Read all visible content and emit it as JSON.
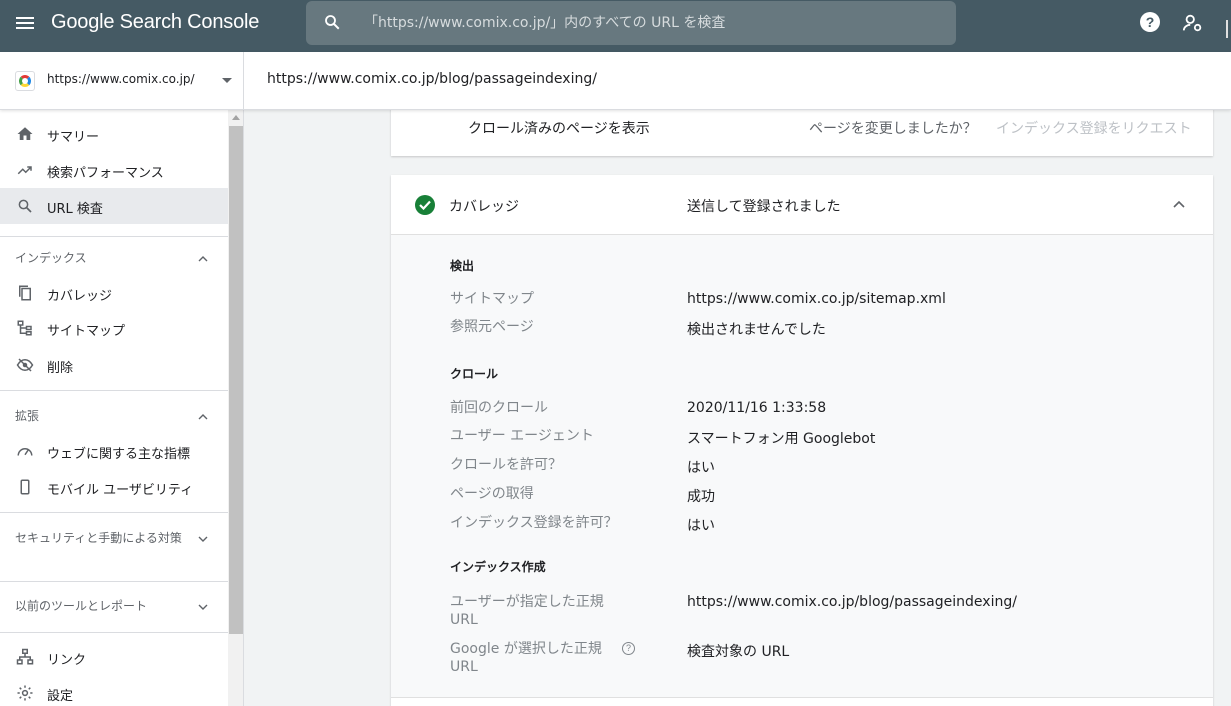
{
  "app": {
    "title": "Google Search Console",
    "search_placeholder": "「https://www.comix.co.jp/」内のすべての URL を検査",
    "help_label": "?"
  },
  "property": {
    "name": "https://www.comix.co.jp/",
    "inspected_url": "https://www.comix.co.jp/blog/passageindexing/"
  },
  "sidebar": {
    "top_items": [
      {
        "label": "サマリー",
        "icon": "home-icon"
      },
      {
        "label": "検索パフォーマンス",
        "icon": "trending-up-icon"
      },
      {
        "label": "URL 検査",
        "icon": "search-icon",
        "active": true
      }
    ],
    "sections": [
      {
        "label": "インデックス",
        "expanded": true,
        "items": [
          {
            "label": "カバレッジ",
            "icon": "copy-icon"
          },
          {
            "label": "サイトマップ",
            "icon": "sitemap-icon"
          },
          {
            "label": "削除",
            "icon": "eye-off-icon"
          }
        ]
      },
      {
        "label": "拡張",
        "expanded": true,
        "items": [
          {
            "label": "ウェブに関する主な指標",
            "icon": "speedometer-icon"
          },
          {
            "label": "モバイル ユーザビリティ",
            "icon": "smartphone-icon"
          }
        ]
      },
      {
        "label": "セキュリティと手動による対策",
        "expanded": false
      },
      {
        "label": "以前のツールとレポート",
        "expanded": false
      }
    ],
    "bottom_items": [
      {
        "label": "リンク",
        "icon": "links-icon"
      },
      {
        "label": "設定",
        "icon": "gear-icon"
      }
    ]
  },
  "top_card": {
    "view_crawled": "クロール済みのページを表示",
    "page_changed": "ページを変更しましたか？",
    "request_indexing": "インデックス登録をリクエスト"
  },
  "coverage": {
    "title": "カバレッジ",
    "status": "送信して登録されました",
    "status_color": "#188038",
    "sections": {
      "discovery": {
        "title": "検出",
        "rows": [
          {
            "label": "サイトマップ",
            "value": "https://www.comix.co.jp/sitemap.xml"
          },
          {
            "label": "参照元ページ",
            "value": "検出されませんでした"
          }
        ]
      },
      "crawl": {
        "title": "クロール",
        "rows": [
          {
            "label": "前回のクロール",
            "value": "2020/11/16 1:33:58"
          },
          {
            "label": "ユーザー エージェント",
            "value": "スマートフォン用 Googlebot"
          },
          {
            "label": "クロールを許可？",
            "value": "はい"
          },
          {
            "label": "ページの取得",
            "value": "成功"
          },
          {
            "label": "インデックス登録を許可？",
            "value": "はい"
          }
        ]
      },
      "indexing": {
        "title": "インデックス作成",
        "rows": [
          {
            "label_line1": "ユーザーが指定した正規",
            "label_line2": "URL",
            "value": "https://www.comix.co.jp/blog/passageindexing/"
          },
          {
            "label_line1": "Google が選択した正規",
            "label_line2": "URL",
            "value": "検査対象の URL"
          }
        ]
      }
    }
  }
}
